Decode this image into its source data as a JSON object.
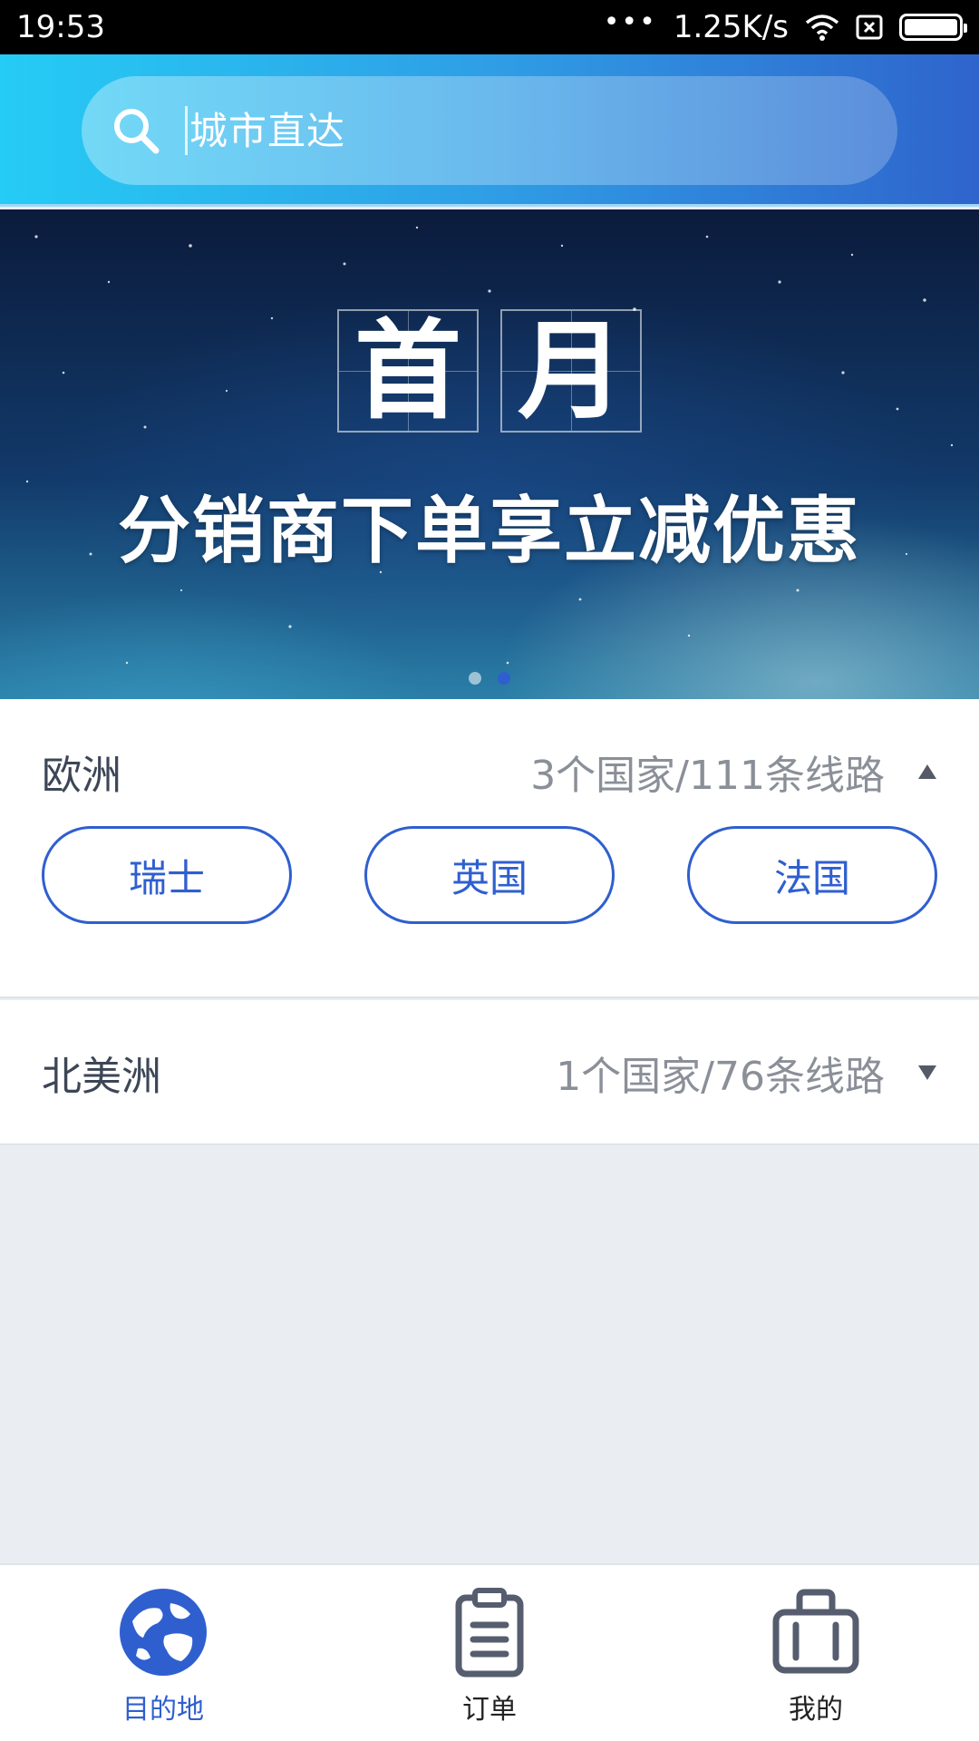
{
  "status_bar": {
    "time": "19:53",
    "dots": "•••",
    "network_speed": "1.25K/s",
    "icons": [
      "wifi-icon",
      "sim-x-icon",
      "battery-icon"
    ]
  },
  "search": {
    "placeholder": "城市直达",
    "icon": "search-icon"
  },
  "banner": {
    "title_chars": [
      "首",
      "月"
    ],
    "subtitle": "分销商下单享立减优惠",
    "page_count": 2,
    "active_index": 1
  },
  "regions": [
    {
      "name": "欧洲",
      "count_text": "3个国家/111条线路",
      "expanded": true,
      "arrow": "triangle-up-icon",
      "countries": [
        "瑞士",
        "英国",
        "法国"
      ]
    },
    {
      "name": "北美洲",
      "count_text": "1个国家/76条线路",
      "expanded": false,
      "arrow": "triangle-down-icon",
      "countries": []
    }
  ],
  "bottom_nav": {
    "items": [
      {
        "label": "目的地",
        "icon": "globe-icon",
        "active": true
      },
      {
        "label": "订单",
        "icon": "clipboard-icon",
        "active": false
      },
      {
        "label": "我的",
        "icon": "suitcase-icon",
        "active": false
      }
    ]
  },
  "colors": {
    "accent": "#2f5fcf",
    "header_start": "#25ccf5",
    "header_end": "#2f64cc",
    "page_bg": "#eaedf2"
  }
}
